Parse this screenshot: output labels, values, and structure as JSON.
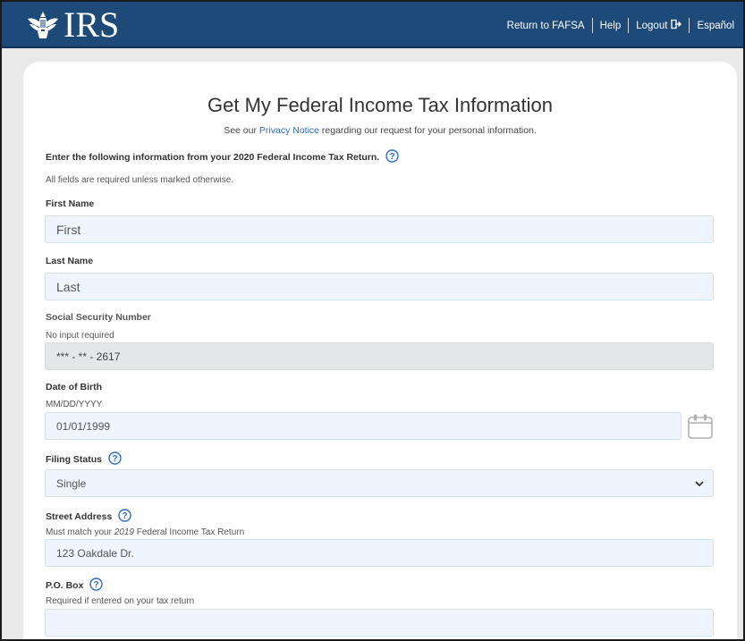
{
  "header": {
    "logo_text": "IRS",
    "nav": {
      "return_fafsa": "Return to FAFSA",
      "help": "Help",
      "logout": "Logout",
      "espanol": "Español"
    },
    "colors": {
      "bar": "#1d4a78",
      "card": "#ffffff",
      "field": "#eef5fc",
      "link": "#2e6dc2"
    }
  },
  "page": {
    "title": "Get My Federal Income Tax Information",
    "privacy_prefix": "See our ",
    "privacy_link": "Privacy Notice",
    "privacy_suffix": " regarding our request for your personal information.",
    "instructions": "Enter the following information from your 2020 Federal Income Tax Return.",
    "required_note": "All fields are required unless marked otherwise."
  },
  "fields": {
    "first_name": {
      "label": "First Name",
      "value": "First"
    },
    "last_name": {
      "label": "Last Name",
      "value": "Last"
    },
    "ssn": {
      "label": "Social Security Number",
      "note": "No input required",
      "value": "*** - ** - 2617"
    },
    "dob": {
      "label": "Date of Birth",
      "note": "MM/DD/YYYY",
      "value": "01/01/1999"
    },
    "filing_status": {
      "label": "Filing Status",
      "value": "Single"
    },
    "street": {
      "label": "Street Address",
      "note_prefix": "Must match your ",
      "note_year": "2019",
      "note_suffix": " Federal Income Tax Return",
      "value": "123 Oakdale Dr."
    },
    "po_box": {
      "label": "P.O. Box",
      "note": "Required if entered on your tax return",
      "value": ""
    }
  },
  "icons": [
    "irs-eagle-icon",
    "logout-icon",
    "help-question-icon",
    "calendar-icon",
    "chevron-down-icon"
  ]
}
